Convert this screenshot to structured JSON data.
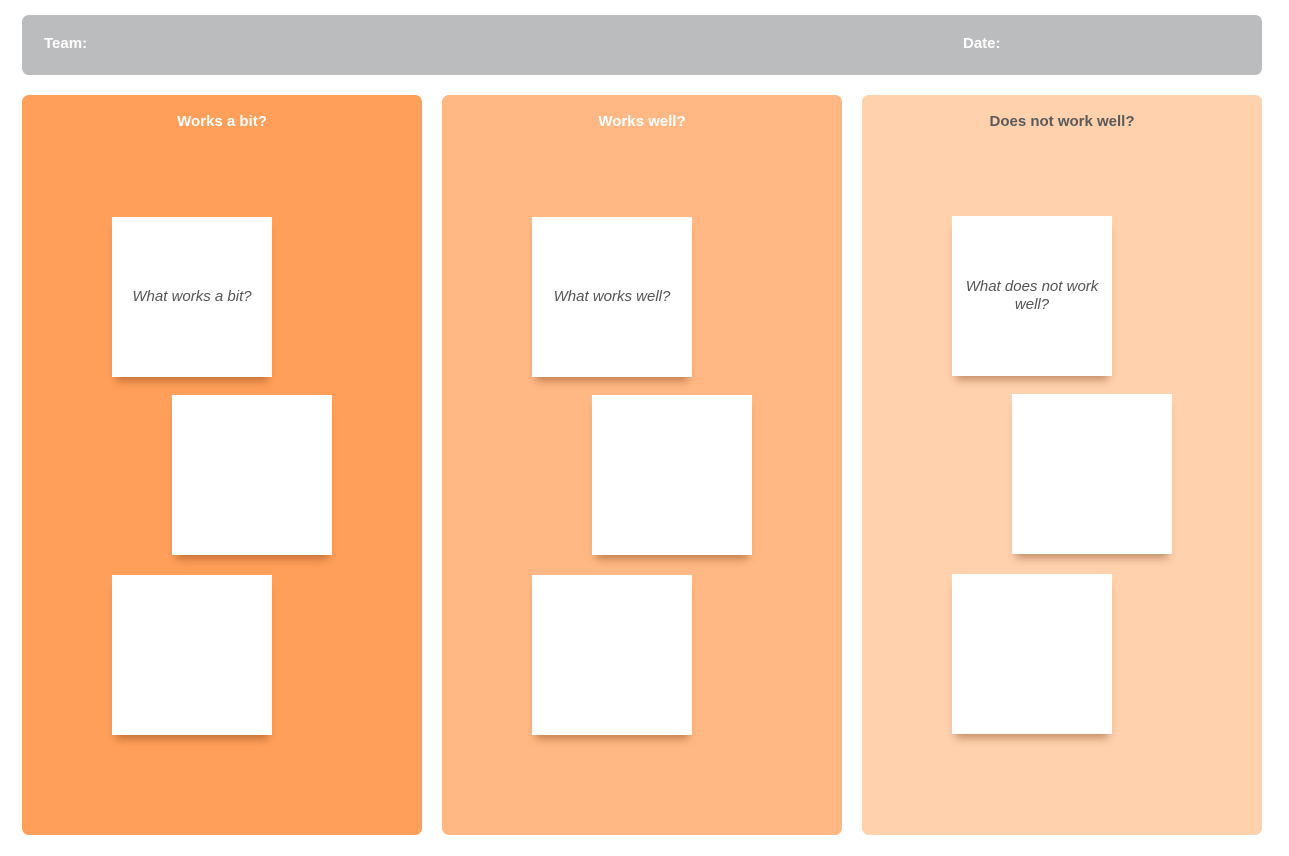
{
  "header": {
    "team_label": "Team:",
    "date_label": "Date:"
  },
  "columns": [
    {
      "title": "Works a bit?",
      "color": "#ff9f59",
      "notes": [
        "What works a bit?",
        "",
        ""
      ]
    },
    {
      "title": "Works well?",
      "color": "#ffb883",
      "notes": [
        "What works well?",
        "",
        ""
      ]
    },
    {
      "title": "Does not work well?",
      "color": "#ffd1ad",
      "notes": [
        "What does not work well?",
        "",
        ""
      ]
    }
  ]
}
